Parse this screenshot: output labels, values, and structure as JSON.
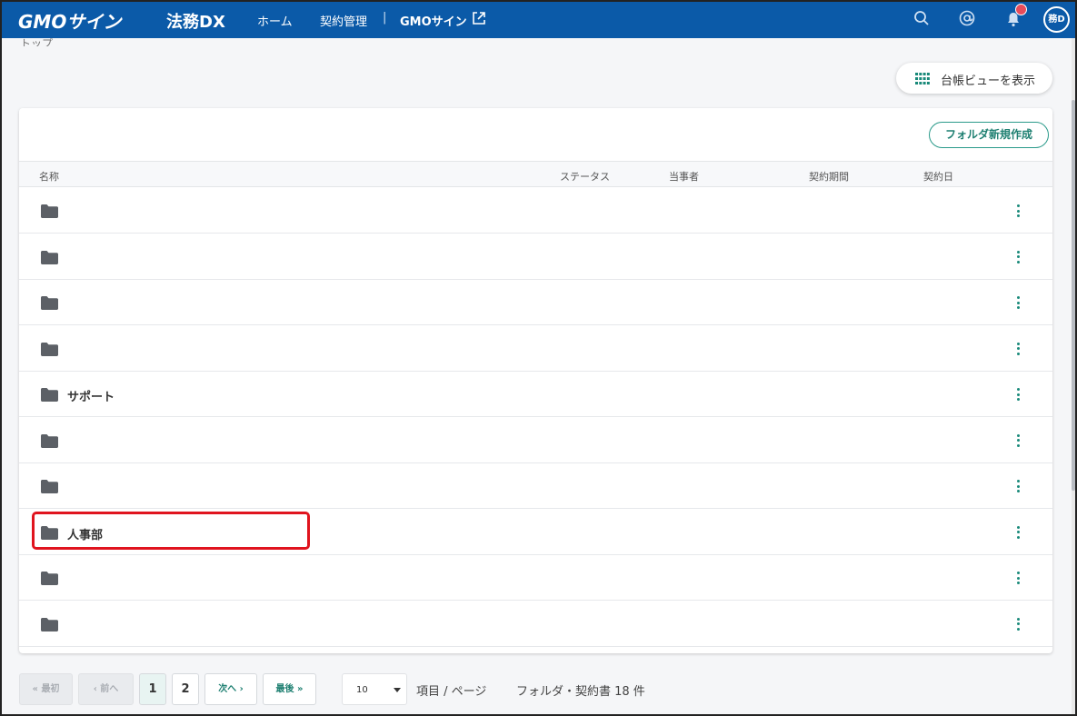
{
  "header": {
    "logo": "GMOサイン",
    "logo_sub": "法務DX",
    "nav": [
      {
        "label": "ホーム"
      },
      {
        "label": "契約管理"
      },
      {
        "label": "GMOサイン"
      }
    ],
    "nav_separator": "|",
    "avatar_text": "務D",
    "icons": [
      "search-icon",
      "mention-icon",
      "bell-icon"
    ]
  },
  "breadcrumb": "トップ",
  "ledger_button": "台帳ビューを表示",
  "new_folder_button": "フォルダ新規作成",
  "columns": {
    "name": "名称",
    "status": "ステータス",
    "party": "当事者",
    "period": "契約期間",
    "date": "契約日"
  },
  "rows": [
    {
      "name": ""
    },
    {
      "name": ""
    },
    {
      "name": ""
    },
    {
      "name": ""
    },
    {
      "name": "サポート"
    },
    {
      "name": ""
    },
    {
      "name": ""
    },
    {
      "name": "人事部"
    },
    {
      "name": ""
    },
    {
      "name": ""
    }
  ],
  "pagination": {
    "first": "最初",
    "prev": "前へ",
    "pages": [
      "1",
      "2"
    ],
    "current": "1",
    "next": "次へ",
    "last": "最後",
    "per_page": "10",
    "per_page_label": "項目 / ページ",
    "total_label": "フォルダ・契約書 18 件"
  },
  "colors": {
    "header_bg": "#0b5aa8",
    "accent": "#1f8072",
    "highlight": "#e0141e",
    "notification": "#e74c5b"
  }
}
